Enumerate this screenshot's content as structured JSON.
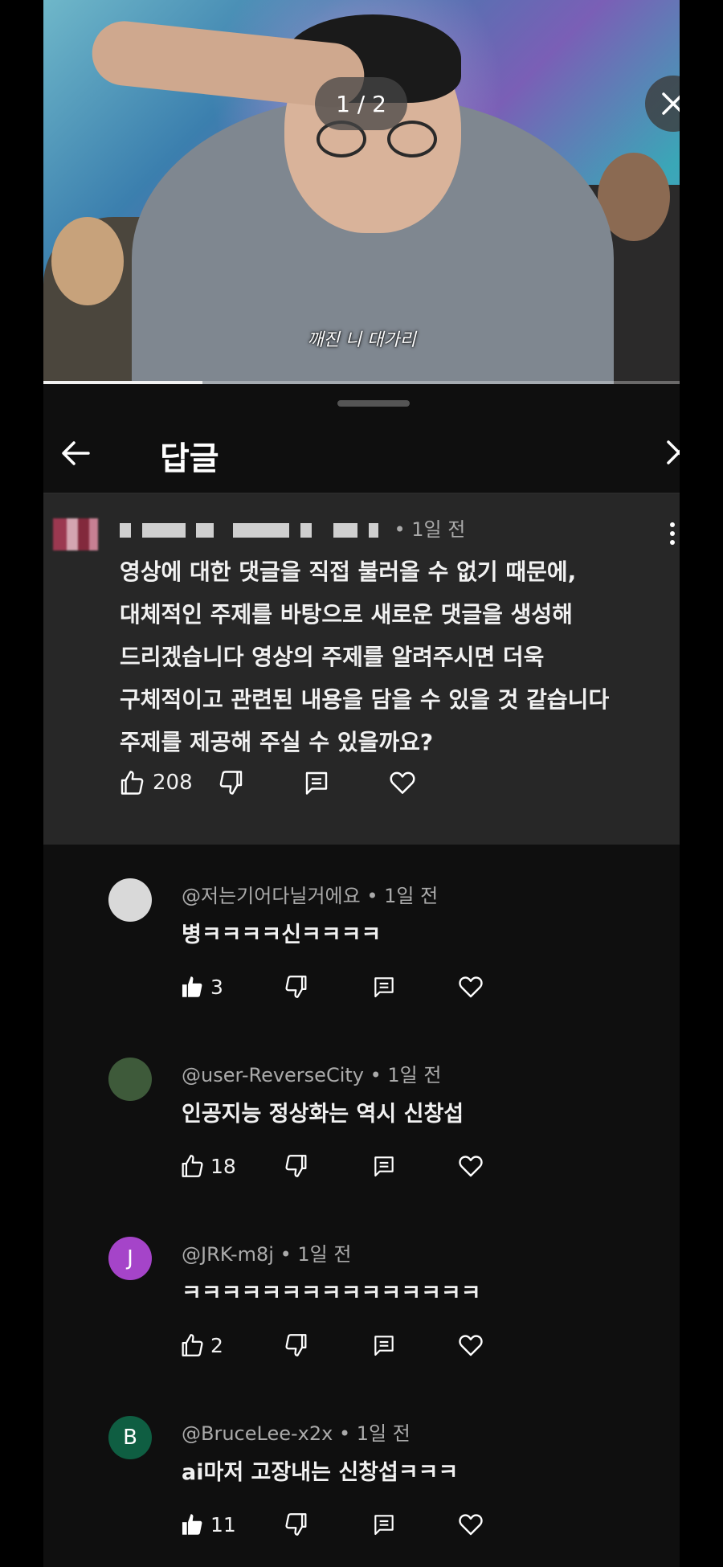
{
  "video": {
    "subtitle": "깨진 니 대가리",
    "page_indicator": "1 / 2",
    "progress_fraction": 0.25
  },
  "sheet": {
    "title": "답글"
  },
  "parent_comment": {
    "time": "• 1일 전",
    "text_lines": [
      "영상에 대한 댓글을 직접 불러올 수 없기 때문에,",
      "대체적인 주제를 바탕으로 새로운 댓글을 생성해",
      "드리겠습니다 영상의 주제를 알려주시면 더욱",
      "구체적이고 관련된 내용을 담을 수 있을 것 같습니다",
      "주제를 제공해 주실 수 있을까요?"
    ],
    "likes": "208"
  },
  "replies": [
    {
      "author": "@저는기어다닐거에요",
      "time": "• 1일 전",
      "text": "병ㅋㅋㅋㅋ신ㅋㅋㅋㅋ",
      "likes": "3",
      "liked": true,
      "avatar_letter": "",
      "avatar_color": "#d9d9d9"
    },
    {
      "author": "@user-ReverseCity",
      "time": "• 1일 전",
      "text": "인공지능 정상화는 역시 신창섭",
      "likes": "18",
      "liked": false,
      "avatar_letter": "",
      "avatar_color": "#3e5a3a"
    },
    {
      "author": "@JRK-m8j",
      "time": "• 1일 전",
      "text": "ㅋㅋㅋㅋㅋㅋㅋㅋㅋㅋㅋㅋㅋㅋㅋ",
      "likes": "2",
      "liked": false,
      "avatar_letter": "J",
      "avatar_color": "#a544c9"
    },
    {
      "author": "@BruceLee-x2x",
      "time": "• 1일 전",
      "text": "ai마저 고장내는 신창섭ㅋㅋㅋ",
      "likes": "11",
      "liked": true,
      "avatar_letter": "B",
      "avatar_color": "#0f5e42"
    }
  ]
}
